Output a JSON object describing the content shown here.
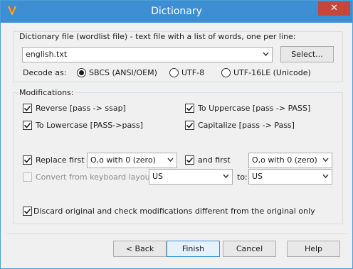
{
  "window": {
    "title": "Dictionary",
    "close_glyph": "✕"
  },
  "dictionary": {
    "label": "Dictionary file (wordlist file) - text file with a list of words, one per line:",
    "file_value": "english.txt",
    "select_label": "Select...",
    "decode_label": "Decode as:",
    "encodings": [
      {
        "label": "SBCS (ANSI/OEM)",
        "selected": true
      },
      {
        "label": "UTF-8",
        "selected": false
      },
      {
        "label": "UTF-16LE (Unicode)",
        "selected": false
      }
    ]
  },
  "modifications": {
    "label": "Modifications:",
    "options": [
      {
        "label": "Reverse [pass -> ssap]",
        "checked": true
      },
      {
        "label": "To Uppercase [pass -> PASS]",
        "checked": true
      },
      {
        "label": "To Lowercase [PASS->pass]",
        "checked": true
      },
      {
        "label": "Capitalize [pass -> Pass]",
        "checked": true
      }
    ],
    "replace_first": {
      "label": "Replace first",
      "checked": true,
      "value": "O,o with 0 (zero)"
    },
    "and_first": {
      "label": "and first",
      "checked": true,
      "value": "O,o with 0 (zero)"
    },
    "keyboard": {
      "label": "Convert from keyboard layout:",
      "checked": false,
      "enabled": false,
      "from_value": "US",
      "to_label": "to:",
      "to_value": "US"
    },
    "discard": {
      "label": "Discard original and check modifications different from the original only",
      "checked": true
    }
  },
  "buttons": {
    "back": "< Back",
    "finish": "Finish",
    "cancel": "Cancel",
    "help": "Help"
  },
  "colors": {
    "titlebar": "#3d8ed2",
    "close": "#c7463b",
    "accent": "#3c8fd6"
  },
  "icons": {
    "app": "dictionary-app-icon",
    "check": "checkmark-icon",
    "dropdown": "chevron-down-icon"
  }
}
